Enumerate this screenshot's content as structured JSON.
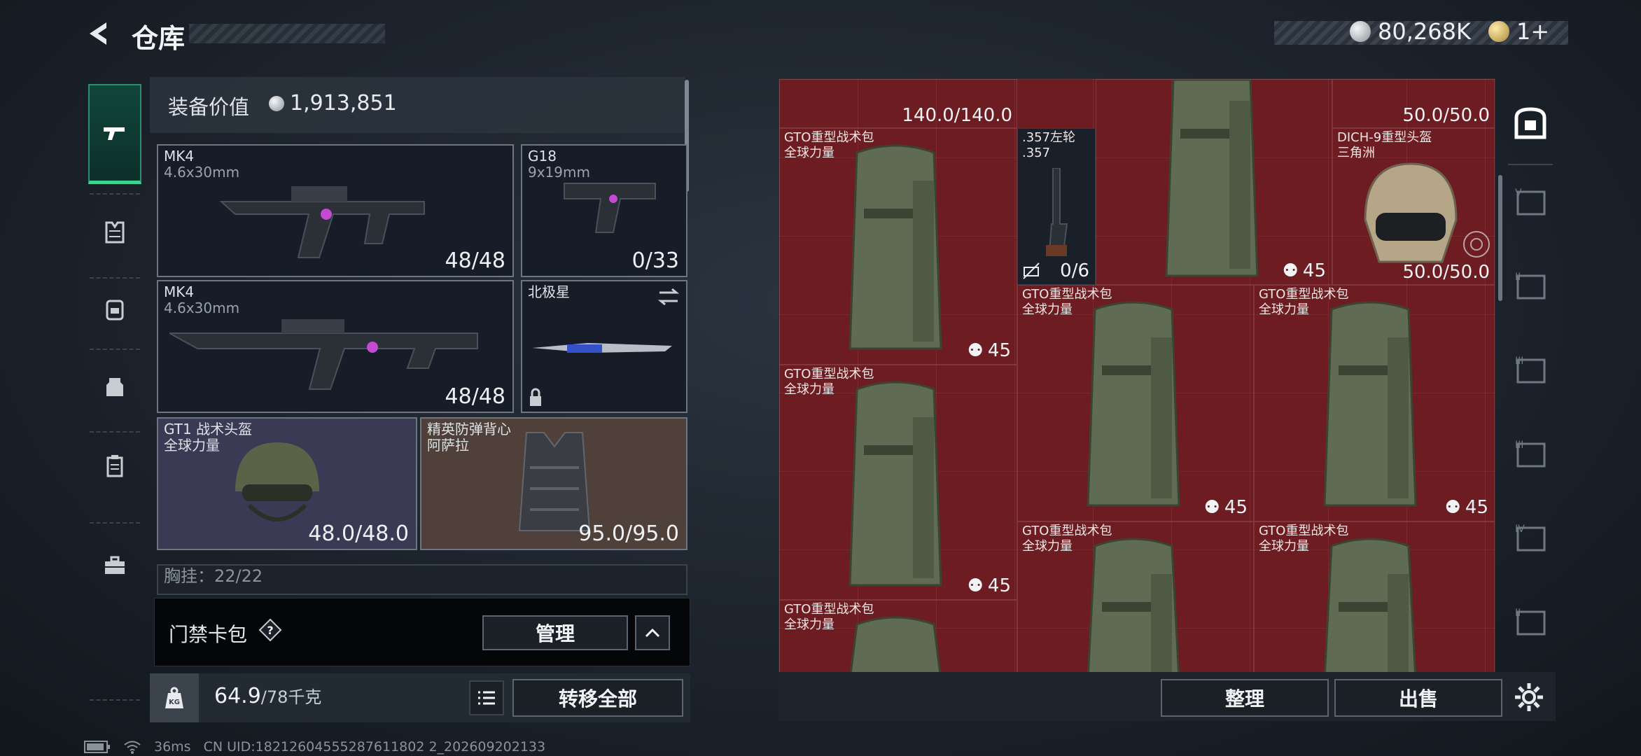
{
  "header": {
    "title": "仓库"
  },
  "currency": {
    "silver": "80,268K",
    "premium": "1+"
  },
  "left_tabs": [
    "gun-icon",
    "armor-vest-icon",
    "backpack-icon",
    "chest-rig-icon",
    "clipboard-icon",
    "toolbox-icon"
  ],
  "equipment": {
    "value_label": "装备价值",
    "value": "1,913,851",
    "slots": [
      {
        "name": "MK4",
        "sub": "4.6x30mm",
        "dur": "48/48"
      },
      {
        "name": "G18",
        "sub": "9x19mm",
        "dur": "0/33"
      },
      {
        "name": "MK4",
        "sub": "4.6x30mm",
        "dur": "48/48"
      },
      {
        "name": "北极星",
        "sub": "",
        "dur": ""
      },
      {
        "name": "GT1 战术头盔",
        "sub": "全球力量",
        "dur": "48.0/48.0"
      },
      {
        "name": "精英防弹背心",
        "sub": "阿萨拉",
        "dur": "95.0/95.0"
      }
    ],
    "next_row_partial": "胸挂：22/22"
  },
  "keycard": {
    "label": "门禁卡包",
    "help": "?",
    "manage": "管理"
  },
  "weight": {
    "current": "64.9",
    "max": "/78千克"
  },
  "transfer_all": "转移全部",
  "grid": {
    "top_partial_durs": [
      "140.0/140.0",
      "50.0/50.0"
    ],
    "items": [
      {
        "name": "GTO重型战术包",
        "sub": "全球力量",
        "count": "45"
      },
      {
        "name": ".357左轮",
        "sub": ".357",
        "count": "0/6"
      },
      {
        "name": "",
        "sub": "",
        "count": "45"
      },
      {
        "name": "DICH-9重型头盔",
        "sub": "三角洲",
        "dur": "50.0/50.0"
      },
      {
        "name": "GTO重型战术包",
        "sub": "全球力量",
        "count": "45"
      },
      {
        "name": "GTO重型战术包",
        "sub": "全球力量",
        "count": "45"
      },
      {
        "name": "GTO重型战术包",
        "sub": "全球力量",
        "count": "45"
      },
      {
        "name": "GTO重型战术包",
        "sub": "全球力量",
        "count": ""
      },
      {
        "name": "GTO重型战术包",
        "sub": "全球力量",
        "count": ""
      },
      {
        "name": "GTO重型战术包",
        "sub": "全球力量",
        "count": ""
      }
    ]
  },
  "right_tabs": [
    "safe-icon",
    "V",
    "II",
    "III",
    "III",
    "IV",
    "II"
  ],
  "actions": {
    "sort": "整理",
    "sell": "出售"
  },
  "status": {
    "ping": "36ms",
    "uid": "CN UID:18212604555287611802 2_202609202133"
  }
}
